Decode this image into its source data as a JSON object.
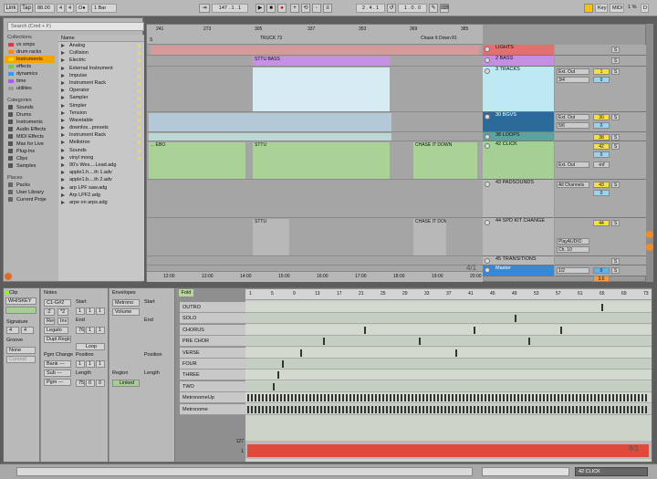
{
  "transport": {
    "link": "Link",
    "tap": "Tap",
    "tempo": "88.00",
    "meter_num": "4",
    "meter_den": "4",
    "metro": "O●",
    "quant": "1 Bar",
    "position": "147 . 1 . 1",
    "loop_start": "2 . 4 . 1",
    "loop_len": "1 . 0 . 0",
    "key": "Key",
    "midi": "MIDI",
    "cpu": "1 %",
    "d": "D"
  },
  "browser": {
    "search_placeholder": "Search (Cmd + F)",
    "collections_head": "Collections",
    "collections": [
      {
        "label": "vx smps",
        "color": "#e33"
      },
      {
        "label": "drum racks",
        "color": "#f80"
      },
      {
        "label": "Instruments",
        "color": "#fc0"
      },
      {
        "label": "effects",
        "color": "#7c3"
      },
      {
        "label": "dynamics",
        "color": "#39f"
      },
      {
        "label": "time",
        "color": "#a5f"
      },
      {
        "label": "utilities",
        "color": "#999"
      }
    ],
    "categories_head": "Categories",
    "categories": [
      "Sounds",
      "Drums",
      "Instruments",
      "Audio Effects",
      "MIDI Effects",
      "Max for Live",
      "Plug-Ins",
      "Clips",
      "Samples"
    ],
    "places_head": "Places",
    "places": [
      "Packs",
      "User Library",
      "Current Proje"
    ],
    "name_head": "Name",
    "items": [
      "Analog",
      "Collision",
      "Electric",
      "External Instrument",
      "Impulse",
      "Instrument Rack",
      "Operator",
      "Sampler",
      "Simpler",
      "Tension",
      "Wavetable",
      "downlos...presets",
      "Instrument Rack",
      "Mellotron",
      "Sounds",
      "vinyl moog",
      "90's Wes....Lead.adg",
      "apple1.h....th 1.adv",
      "apple1.b....th 2.adv",
      "arp LPF saw.adg",
      "Arp LPF2.adg",
      "arpe on arps.adg"
    ]
  },
  "arrangement": {
    "bars": [
      "241",
      "273",
      "305",
      "337",
      "353",
      "369",
      "385"
    ],
    "locators": [
      "TRUCK 73",
      "Chase It Down 81"
    ],
    "clips": {
      "bass": "STTU BASS",
      "ebo": "... EBO",
      "sttu": "STTU",
      "chase": "CHASE IT DOWN",
      "sttu2": "STTU",
      "chase2": "CHASE IT DOW"
    },
    "tracks": [
      {
        "name": "LIGHTS",
        "color": "#e36f6f",
        "vol": "",
        "n": ""
      },
      {
        "name": "2 BASS",
        "color": "#c48fe0",
        "vol": "",
        "n": ""
      },
      {
        "name": "3 TRACKS",
        "color": "#bde9f3",
        "vol": "1",
        "n": "0"
      },
      {
        "name": "30 BGVS",
        "color": "#2c6a9a",
        "vol": "30",
        "n": "0"
      },
      {
        "name": "38 LOOPS",
        "color": "#5aa4a0",
        "vol": "38",
        "n": ""
      },
      {
        "name": "42 CLICK",
        "color": "#a6cf94",
        "vol": "42",
        "n": "0"
      },
      {
        "name": "43 PADSOUNDS",
        "color": "#b8b8b8",
        "vol": "43",
        "n": "0"
      },
      {
        "name": "44 SPD KIT CHANGE",
        "color": "#b8b8b8",
        "vol": "44",
        "n": ""
      },
      {
        "name": "45 TRANSITIONS",
        "color": "#b8b8b8",
        "vol": "",
        "n": ""
      },
      {
        "name": "Master",
        "color": "#3a87d6",
        "vol": "0",
        "n": "3.6"
      }
    ],
    "io": {
      "ext_out": "Ext. Out",
      "ii": "ii",
      "ch34": "3/4",
      "ch56": "5/6",
      "all_channels": "All Channels",
      "ch10": "Ch. 10",
      "play_audio": "PlayAUDIO",
      "half": "1/2",
      "neg_inf": "-inf",
      "c": "C",
      "s": "S"
    },
    "times": [
      "12:00",
      "13:00",
      "14:00",
      "15:00",
      "16:00",
      "17:00",
      "18:00",
      "19:00",
      "20:00"
    ],
    "zoom": "4/1"
  },
  "detail": {
    "clip_label": "Clip",
    "clip_name": "WHISKEY",
    "signature_label": "Signature",
    "sig_num": "4",
    "sig_den": "4",
    "groove_label": "Groove",
    "groove_val": "None",
    "commit": "Commit",
    "notes_label": "Notes",
    "range": "C1-G#2",
    "start_label": "Start",
    "end_label": "End",
    "start_vals": [
      "1",
      "1",
      "1"
    ],
    "end_vals": [
      "76",
      "1",
      "1"
    ],
    "half": ":2",
    "dbl": "*2",
    "rev": "Rev",
    "inv": "Inv",
    "legato": "Legato",
    "dupl": "Dupl.Region",
    "loop": "Loop",
    "position_label": "Position",
    "length_label": "Length",
    "pos_vals": [
      "1",
      "1",
      "1"
    ],
    "len_vals": [
      "75",
      "0",
      "0"
    ],
    "pgm": "Pgm Change",
    "bank": "Bank ---",
    "sub": "Sub ---",
    "pgm_val": "Pgm ---",
    "envelopes": "Envelopes",
    "env_src": "Metrono",
    "env_ctrl": "Volume",
    "region": "Region",
    "linked": "Linked",
    "fold": "Fold",
    "bars": [
      "1",
      "5",
      "9",
      "13",
      "17",
      "21",
      "25",
      "29",
      "33",
      "37",
      "41",
      "45",
      "49",
      "53",
      "57",
      "61",
      "65",
      "69",
      "73"
    ],
    "rows": [
      "OUTRO",
      "SOLO",
      "CHORUS",
      "PRE CHOR",
      "VERSE",
      "FOUR",
      "THREE",
      "TWO",
      "MetronomeUp",
      "Metronome"
    ],
    "vel_max": "127",
    "vel_min": "1",
    "zoom": "8/1"
  },
  "status": {
    "track": "42 CLICK"
  }
}
